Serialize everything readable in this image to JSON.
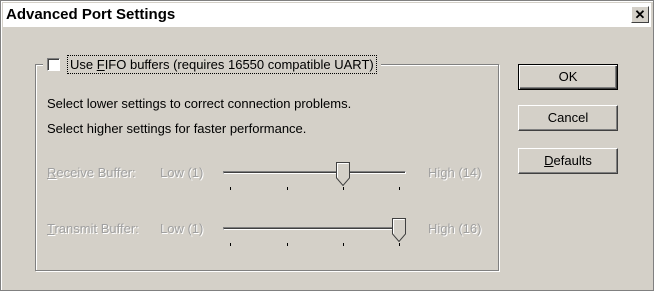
{
  "window": {
    "title": "Advanced Port Settings",
    "close_glyph": "✕"
  },
  "fifo": {
    "checked": false,
    "label_prefix": "Use ",
    "label_hotkey": "F",
    "label_rest": "IFO buffers (requires 16550 compatible UART)"
  },
  "info": {
    "line1": "Select lower settings to correct connection problems.",
    "line2": "Select higher settings for faster performance."
  },
  "receive": {
    "hotkey": "R",
    "label_rest": "eceive Buffer:",
    "low": "Low (1)",
    "high": "High (14)",
    "value_fraction": 0.667,
    "enabled": false
  },
  "transmit": {
    "hotkey": "T",
    "label_rest": "ransmit Buffer:",
    "low": "Low (1)",
    "high": "High (16)",
    "value_fraction": 1.0,
    "enabled": false
  },
  "buttons": {
    "ok": "OK",
    "cancel": "Cancel",
    "defaults_hotkey": "D",
    "defaults_rest": "efaults"
  }
}
